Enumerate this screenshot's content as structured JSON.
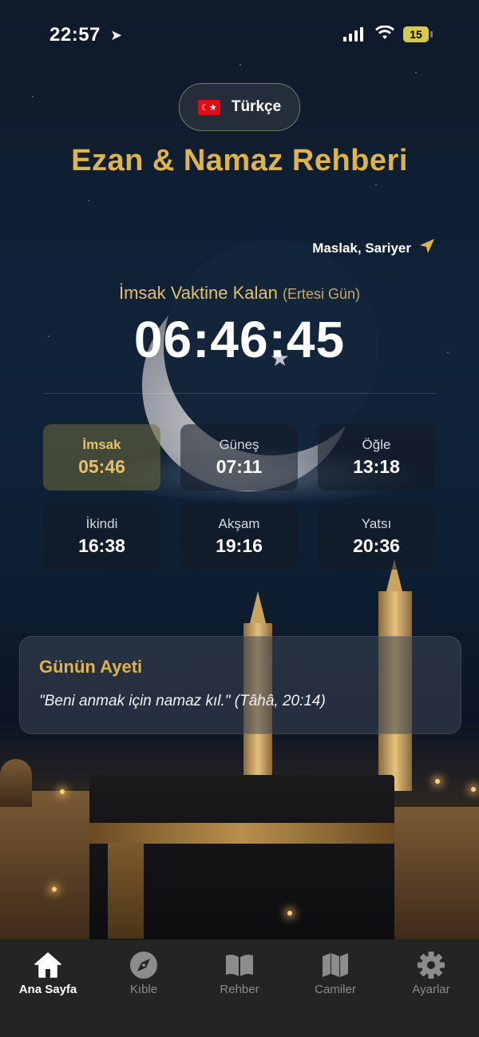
{
  "status_bar": {
    "time": "22:57",
    "battery": "15"
  },
  "language": {
    "label": "Türkçe"
  },
  "app_title": "Ezan & Namaz Rehberi",
  "location": {
    "name": "Maslak, Sariyer"
  },
  "countdown": {
    "label": "İmsak Vaktine Kalan",
    "sublabel": "(Ertesi Gün)",
    "value": "06:46:45"
  },
  "prayers": [
    {
      "name": "İmsak",
      "time": "05:46",
      "active": true
    },
    {
      "name": "Güneş",
      "time": "07:11"
    },
    {
      "name": "Öğle",
      "time": "13:18"
    },
    {
      "name": "İkindi",
      "time": "16:38"
    },
    {
      "name": "Akşam",
      "time": "19:16"
    },
    {
      "name": "Yatsı",
      "time": "20:36"
    }
  ],
  "verse": {
    "title": "Günün Ayeti",
    "text": "\"Beni anmak için namaz kıl.\" (Tâhâ, 20:14)"
  },
  "tabs": [
    {
      "label": "Ana Sayfa",
      "icon": "home-icon",
      "active": true
    },
    {
      "label": "Kıble",
      "icon": "compass-icon"
    },
    {
      "label": "Rehber",
      "icon": "book-icon"
    },
    {
      "label": "Camiler",
      "icon": "map-icon"
    },
    {
      "label": "Ayarlar",
      "icon": "gear-icon"
    }
  ],
  "colors": {
    "accent": "#e0b547",
    "tabbar": "#242424"
  }
}
